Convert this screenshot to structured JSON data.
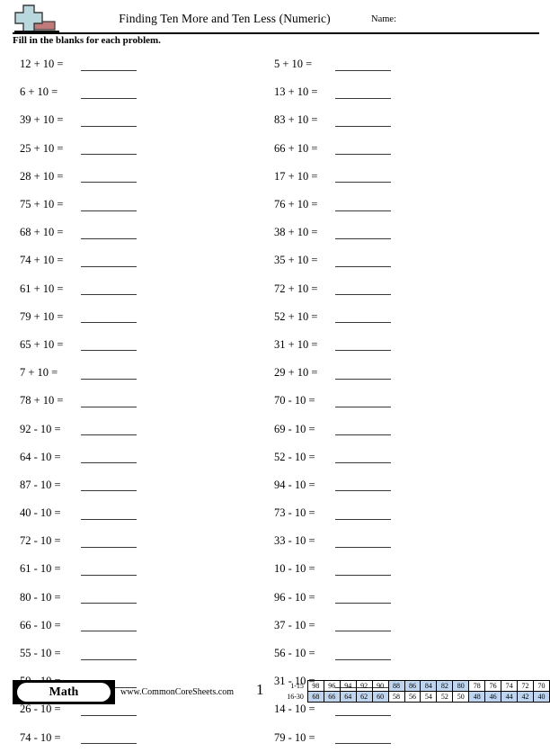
{
  "header": {
    "title": "Finding Ten More and Ten Less (Numeric)",
    "name_label": "Name:",
    "instructions": "Fill in the blanks for each problem.",
    "logo_icon": "plus-block-logo"
  },
  "columns": {
    "left": [
      {
        "expr": "12 + 10 ="
      },
      {
        "expr": "6 + 10 ="
      },
      {
        "expr": "39 + 10 ="
      },
      {
        "expr": "25 + 10 ="
      },
      {
        "expr": "28 + 10 ="
      },
      {
        "expr": "75 + 10 ="
      },
      {
        "expr": "68 + 10 ="
      },
      {
        "expr": "74 + 10 ="
      },
      {
        "expr": "61 + 10 ="
      },
      {
        "expr": "79 + 10 ="
      },
      {
        "expr": "65 + 10 ="
      },
      {
        "expr": "7 + 10 ="
      },
      {
        "expr": "78 + 10 ="
      },
      {
        "expr": "92 - 10 ="
      },
      {
        "expr": "64 - 10 ="
      },
      {
        "expr": "87 - 10 ="
      },
      {
        "expr": "40 - 10 ="
      },
      {
        "expr": "72 - 10 ="
      },
      {
        "expr": "61 - 10 ="
      },
      {
        "expr": "80 - 10 ="
      },
      {
        "expr": "66 - 10 ="
      },
      {
        "expr": "55 - 10 ="
      },
      {
        "expr": "59 - 10 ="
      },
      {
        "expr": "26 - 10 ="
      },
      {
        "expr": "74 - 10 ="
      }
    ],
    "right": [
      {
        "expr": "5 + 10 ="
      },
      {
        "expr": "13 + 10 ="
      },
      {
        "expr": "83 + 10 ="
      },
      {
        "expr": "66 + 10 ="
      },
      {
        "expr": "17 + 10 ="
      },
      {
        "expr": "76 + 10 ="
      },
      {
        "expr": "38 + 10 ="
      },
      {
        "expr": "35 + 10 ="
      },
      {
        "expr": "72 + 10 ="
      },
      {
        "expr": "52 + 10 ="
      },
      {
        "expr": "31 + 10 ="
      },
      {
        "expr": "29 + 10 ="
      },
      {
        "expr": "70 - 10 ="
      },
      {
        "expr": "69 - 10 ="
      },
      {
        "expr": "52 - 10 ="
      },
      {
        "expr": "94 - 10 ="
      },
      {
        "expr": "73 - 10 ="
      },
      {
        "expr": "33 - 10 ="
      },
      {
        "expr": "10 - 10 ="
      },
      {
        "expr": "96 - 10 ="
      },
      {
        "expr": "37 - 10 ="
      },
      {
        "expr": "56 - 10 ="
      },
      {
        "expr": "31 - 10 ="
      },
      {
        "expr": "14 - 10 ="
      },
      {
        "expr": "79 - 10 ="
      }
    ]
  },
  "footer": {
    "subject_label": "Math",
    "site_url": "www.CommonCoreSheets.com",
    "page_number": "1",
    "answer_key": {
      "highlight_color": "#bfd5ef",
      "rows": [
        {
          "label": "1-15",
          "cells": [
            {
              "value": "98",
              "highlighted": false
            },
            {
              "value": "96",
              "highlighted": false
            },
            {
              "value": "94",
              "highlighted": false
            },
            {
              "value": "92",
              "highlighted": false
            },
            {
              "value": "90",
              "highlighted": false
            },
            {
              "value": "88",
              "highlighted": true
            },
            {
              "value": "86",
              "highlighted": true
            },
            {
              "value": "84",
              "highlighted": true
            },
            {
              "value": "82",
              "highlighted": true
            },
            {
              "value": "80",
              "highlighted": true
            },
            {
              "value": "78",
              "highlighted": false
            },
            {
              "value": "76",
              "highlighted": false
            },
            {
              "value": "74",
              "highlighted": false
            },
            {
              "value": "72",
              "highlighted": false
            },
            {
              "value": "70",
              "highlighted": false
            }
          ]
        },
        {
          "label": "16-30",
          "cells": [
            {
              "value": "68",
              "highlighted": true
            },
            {
              "value": "66",
              "highlighted": true
            },
            {
              "value": "64",
              "highlighted": true
            },
            {
              "value": "62",
              "highlighted": true
            },
            {
              "value": "60",
              "highlighted": true
            },
            {
              "value": "58",
              "highlighted": false
            },
            {
              "value": "56",
              "highlighted": false
            },
            {
              "value": "54",
              "highlighted": false
            },
            {
              "value": "52",
              "highlighted": false
            },
            {
              "value": "50",
              "highlighted": false
            },
            {
              "value": "48",
              "highlighted": true
            },
            {
              "value": "46",
              "highlighted": true
            },
            {
              "value": "44",
              "highlighted": true
            },
            {
              "value": "42",
              "highlighted": true
            },
            {
              "value": "40",
              "highlighted": true
            }
          ]
        }
      ]
    }
  }
}
